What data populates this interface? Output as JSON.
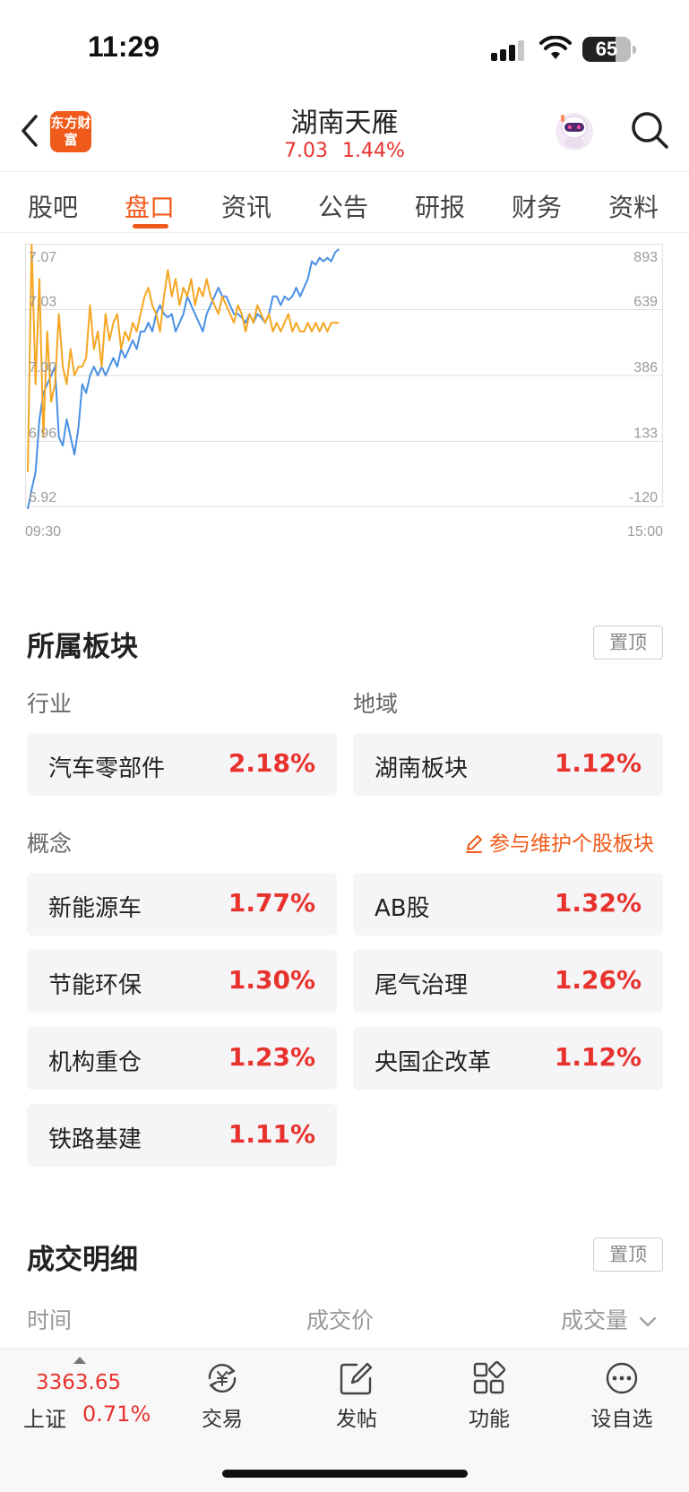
{
  "status": {
    "time": "11:29",
    "battery": "65"
  },
  "header": {
    "brand_logo": "东方财富",
    "title": "湖南天雁",
    "price": "7.03",
    "change_pct": "1.44%"
  },
  "tabs": [
    {
      "label": "股吧",
      "active": false
    },
    {
      "label": "盘口",
      "active": true
    },
    {
      "label": "资讯",
      "active": false
    },
    {
      "label": "公告",
      "active": false
    },
    {
      "label": "研报",
      "active": false
    },
    {
      "label": "财务",
      "active": false
    },
    {
      "label": "资料",
      "active": false
    }
  ],
  "chart_data": {
    "type": "line",
    "x_labels": [
      "09:30",
      "15:00"
    ],
    "y_left_ticks": [
      "7.07",
      "7.03",
      "7.00",
      "6.96",
      "6.92"
    ],
    "y_right_ticks": [
      "893",
      "639",
      "386",
      "133",
      "-120"
    ],
    "ylim_left": [
      6.92,
      7.07
    ],
    "ylim_right": [
      -120,
      893
    ],
    "grid": true,
    "colors": {
      "price": "#4a90e2",
      "avg": "#f5a623"
    },
    "series": [
      {
        "key": "price",
        "values": [
          6.919,
          6.93,
          6.94,
          6.97,
          6.985,
          6.99,
          6.995,
          7.0,
          6.96,
          6.955,
          6.97,
          6.96,
          6.95,
          6.965,
          6.99,
          6.985,
          6.995,
          7.0,
          6.995,
          7.0,
          6.995,
          7.0,
          7.005,
          7.0,
          7.01,
          7.005,
          7.01,
          7.015,
          7.01,
          7.02,
          7.02,
          7.025,
          7.02,
          7.03,
          7.035,
          7.03,
          7.028,
          7.03,
          7.02,
          7.025,
          7.03,
          7.04,
          7.035,
          7.03,
          7.025,
          7.02,
          7.03,
          7.035,
          7.04,
          7.045,
          7.04,
          7.04,
          7.035,
          7.03,
          7.03,
          7.028,
          7.025,
          7.03,
          7.025,
          7.03,
          7.028,
          7.025,
          7.03,
          7.04,
          7.04,
          7.035,
          7.04,
          7.038,
          7.04,
          7.045,
          7.04,
          7.045,
          7.05,
          7.06,
          7.058,
          7.062,
          7.06,
          7.062,
          7.06,
          7.065,
          7.067
        ]
      },
      {
        "key": "avg",
        "values": [
          6.94,
          7.07,
          6.99,
          7.05,
          6.96,
          7.02,
          6.98,
          6.99,
          7.03,
          7.0,
          6.99,
          7.01,
          6.995,
          7.0,
          7.0,
          7.005,
          7.035,
          7.01,
          7.02,
          7.0,
          7.03,
          7.015,
          7.025,
          7.03,
          7.01,
          7.02,
          7.015,
          7.025,
          7.02,
          7.03,
          7.04,
          7.045,
          7.035,
          7.03,
          7.02,
          7.04,
          7.055,
          7.04,
          7.05,
          7.035,
          7.045,
          7.04,
          7.05,
          7.035,
          7.045,
          7.04,
          7.05,
          7.04,
          7.035,
          7.03,
          7.04,
          7.035,
          7.03,
          7.025,
          7.035,
          7.03,
          7.02,
          7.03,
          7.025,
          7.035,
          7.03,
          7.025,
          7.03,
          7.02,
          7.025,
          7.02,
          7.025,
          7.03,
          7.02,
          7.025,
          7.02,
          7.02,
          7.025,
          7.02,
          7.025,
          7.02,
          7.025,
          7.02,
          7.025,
          7.025,
          7.025
        ]
      }
    ]
  },
  "sectors": {
    "title": "所属板块",
    "pin_label": "置顶",
    "industry_label": "行业",
    "region_label": "地域",
    "concept_label": "概念",
    "edit_link": "参与维护个股板块",
    "industry": [
      {
        "name": "汽车零部件",
        "pct": "2.18%"
      }
    ],
    "region": [
      {
        "name": "湖南板块",
        "pct": "1.12%"
      }
    ],
    "concepts": [
      {
        "name": "新能源车",
        "pct": "1.77%"
      },
      {
        "name": "AB股",
        "pct": "1.32%"
      },
      {
        "name": "节能环保",
        "pct": "1.30%"
      },
      {
        "name": "尾气治理",
        "pct": "1.26%"
      },
      {
        "name": "机构重仓",
        "pct": "1.23%"
      },
      {
        "name": "央国企改革",
        "pct": "1.12%"
      },
      {
        "name": "铁路基建",
        "pct": "1.11%"
      }
    ]
  },
  "trades": {
    "title": "成交明细",
    "pin_label": "置顶",
    "col_time": "时间",
    "col_price": "成交价",
    "col_volume": "成交量"
  },
  "bottom_bar": {
    "index_value": "3363.65",
    "index_name": "上证",
    "index_pct": "0.71%",
    "items": [
      {
        "label": "交易",
        "icon": "yen-cycle-icon"
      },
      {
        "label": "发帖",
        "icon": "compose-icon"
      },
      {
        "label": "功能",
        "icon": "grid-icon"
      },
      {
        "label": "设自选",
        "icon": "more-dots-icon"
      }
    ]
  }
}
